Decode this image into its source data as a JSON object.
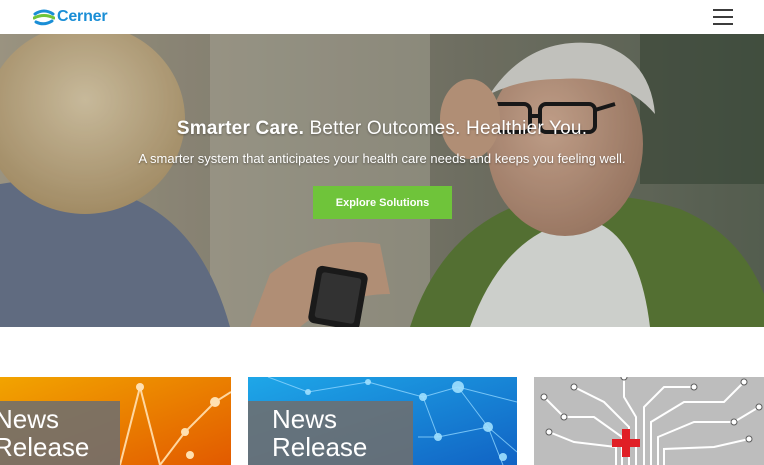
{
  "header": {
    "logo_text": "Cerner",
    "menu_icon": "hamburger-menu-icon"
  },
  "hero": {
    "title_strong": "Smarter Care.",
    "title_rest": " Better Outcomes. Healthier You.",
    "subtitle": "A smarter system that anticipates your health care needs and keeps you feeling well.",
    "cta_label": "Explore Solutions"
  },
  "cards": [
    {
      "line1": "News",
      "line2": "Release"
    },
    {
      "line1": "News",
      "line2": "Release"
    },
    {
      "image": "circuit-tree-medical-cross"
    }
  ],
  "colors": {
    "brand_blue": "#1a8ed6",
    "brand_green": "#6fc43a",
    "cta_green": "#6fc43a"
  }
}
